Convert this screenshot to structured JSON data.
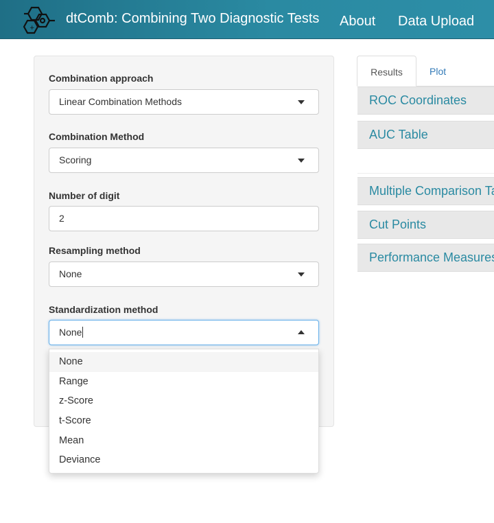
{
  "navbar": {
    "brand": "dtComb: Combining Two Diagnostic Tests",
    "links": [
      "About",
      "Data Upload"
    ],
    "logo_icon": "hexagon-molecule-icon",
    "color": "#2a8aa2"
  },
  "sidebar": {
    "combination_approach": {
      "label": "Combination approach",
      "value": "Linear Combination Methods"
    },
    "combination_method": {
      "label": "Combination Method",
      "value": "Scoring"
    },
    "number_of_digit": {
      "label": "Number of digit",
      "value": "2"
    },
    "resampling_method": {
      "label": "Resampling method",
      "value": "None"
    },
    "standardization_method": {
      "label": "Standardization method",
      "value": "None",
      "options": [
        "None",
        "Range",
        "z-Score",
        "t-Score",
        "Mean",
        "Deviance"
      ]
    }
  },
  "tabs": [
    "Results",
    "Plot"
  ],
  "panels": [
    "ROC Coordinates",
    "AUC Table",
    "Multiple Comparison Ta",
    "Cut Points",
    "Performance Measures"
  ]
}
